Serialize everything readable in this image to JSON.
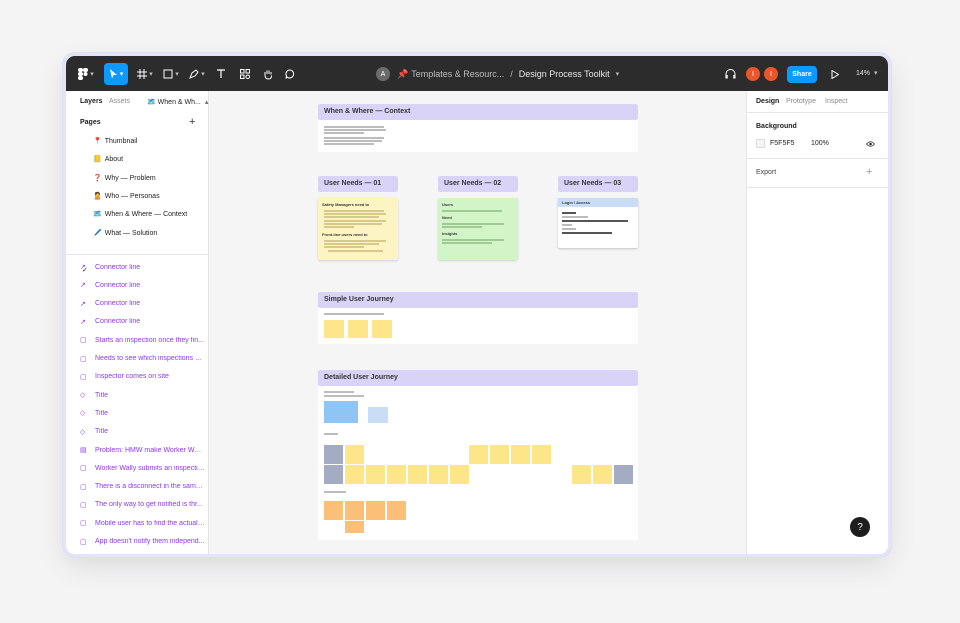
{
  "toolbar": {
    "breadcrumb_project": "Templates & Resourc...",
    "breadcrumb_sep": "/",
    "breadcrumb_file": "Design Process Toolkit",
    "avatar_initial": "A",
    "collab_initial_1": "I",
    "collab_initial_2": "I",
    "share_label": "Share",
    "zoom": "14%"
  },
  "left_panel": {
    "tab_layers": "Layers",
    "tab_assets": "Assets",
    "current_page": "When & Wh...",
    "pages_heading": "Pages",
    "pages": [
      {
        "emoji": "📍",
        "label": "Thumbnail"
      },
      {
        "emoji": "📒",
        "label": "About"
      },
      {
        "emoji": "❓",
        "label": "Why — Problem"
      },
      {
        "emoji": "🙎",
        "label": "Who — Personas"
      },
      {
        "emoji": "🗺️",
        "label": "When & Where — Context"
      },
      {
        "emoji": "🖊️",
        "label": "What — Solution"
      }
    ],
    "selected_check": "✓",
    "layers": [
      {
        "icon": "connector-icon",
        "label": "Connector line"
      },
      {
        "icon": "connector-icon",
        "label": "Connector line"
      },
      {
        "icon": "connector-icon",
        "label": "Connector line"
      },
      {
        "icon": "connector-icon",
        "label": "Connector line"
      },
      {
        "icon": "sticky-icon",
        "label": "Starts an inspection once they fin..."
      },
      {
        "icon": "sticky-icon",
        "label": "Needs to see which inspections ar..."
      },
      {
        "icon": "sticky-icon",
        "label": "Inspector comes on site"
      },
      {
        "icon": "diamond-icon",
        "label": "Title"
      },
      {
        "icon": "diamond-icon",
        "label": "Title"
      },
      {
        "icon": "diamond-icon",
        "label": "Title"
      },
      {
        "icon": "text-icon",
        "label": "Problem: HMW make Worker Wally..."
      },
      {
        "icon": "sticky-icon",
        "label": "Worker Wally submits an inspectio..."
      },
      {
        "icon": "sticky-icon",
        "label": "There is a disconnect in the same ..."
      },
      {
        "icon": "sticky-icon",
        "label": "The only way to get notified is thr..."
      },
      {
        "icon": "sticky-icon",
        "label": "Mobile user has to find the actual r..."
      },
      {
        "icon": "sticky-icon",
        "label": "App doesn't notify them independ..."
      }
    ]
  },
  "right_panel": {
    "tab_design": "Design",
    "tab_prototype": "Prototype",
    "tab_inspect": "Inspect",
    "background_heading": "Background",
    "background_hex": "F5F5F5",
    "background_opacity": "100%",
    "export_label": "Export"
  },
  "canvas": {
    "context_title": "When & Where — Context",
    "user_needs_1": "User Needs — 01",
    "user_needs_2": "User Needs — 02",
    "user_needs_3": "User Needs — 03",
    "card1_heading": "Safety Managers need to",
    "card1_subheading": "Front-line users need to",
    "card2_heading": "Users",
    "card2_subheading_1": "Need",
    "card2_subheading_2": "Insights",
    "card3_heading": "Login / Access",
    "simple_journey_title": "Simple User Journey",
    "detailed_journey_title": "Detailed User Journey"
  },
  "help_label": "?",
  "colors": {
    "toolbar_bg": "#2c2c2c",
    "accent_blue": "#0d99ff",
    "layer_purple": "#8a38f5",
    "section_header": "#d9d4f7",
    "sticky_yellow": "#fde68a",
    "sticky_orange": "#fbbf77",
    "sticky_gray": "#a3acc2",
    "sticky_blue": "#8ec5f5",
    "card_yellow": "#fdf4c4",
    "card_green": "#d2f5c8",
    "avatar_red": "#e8562a"
  }
}
